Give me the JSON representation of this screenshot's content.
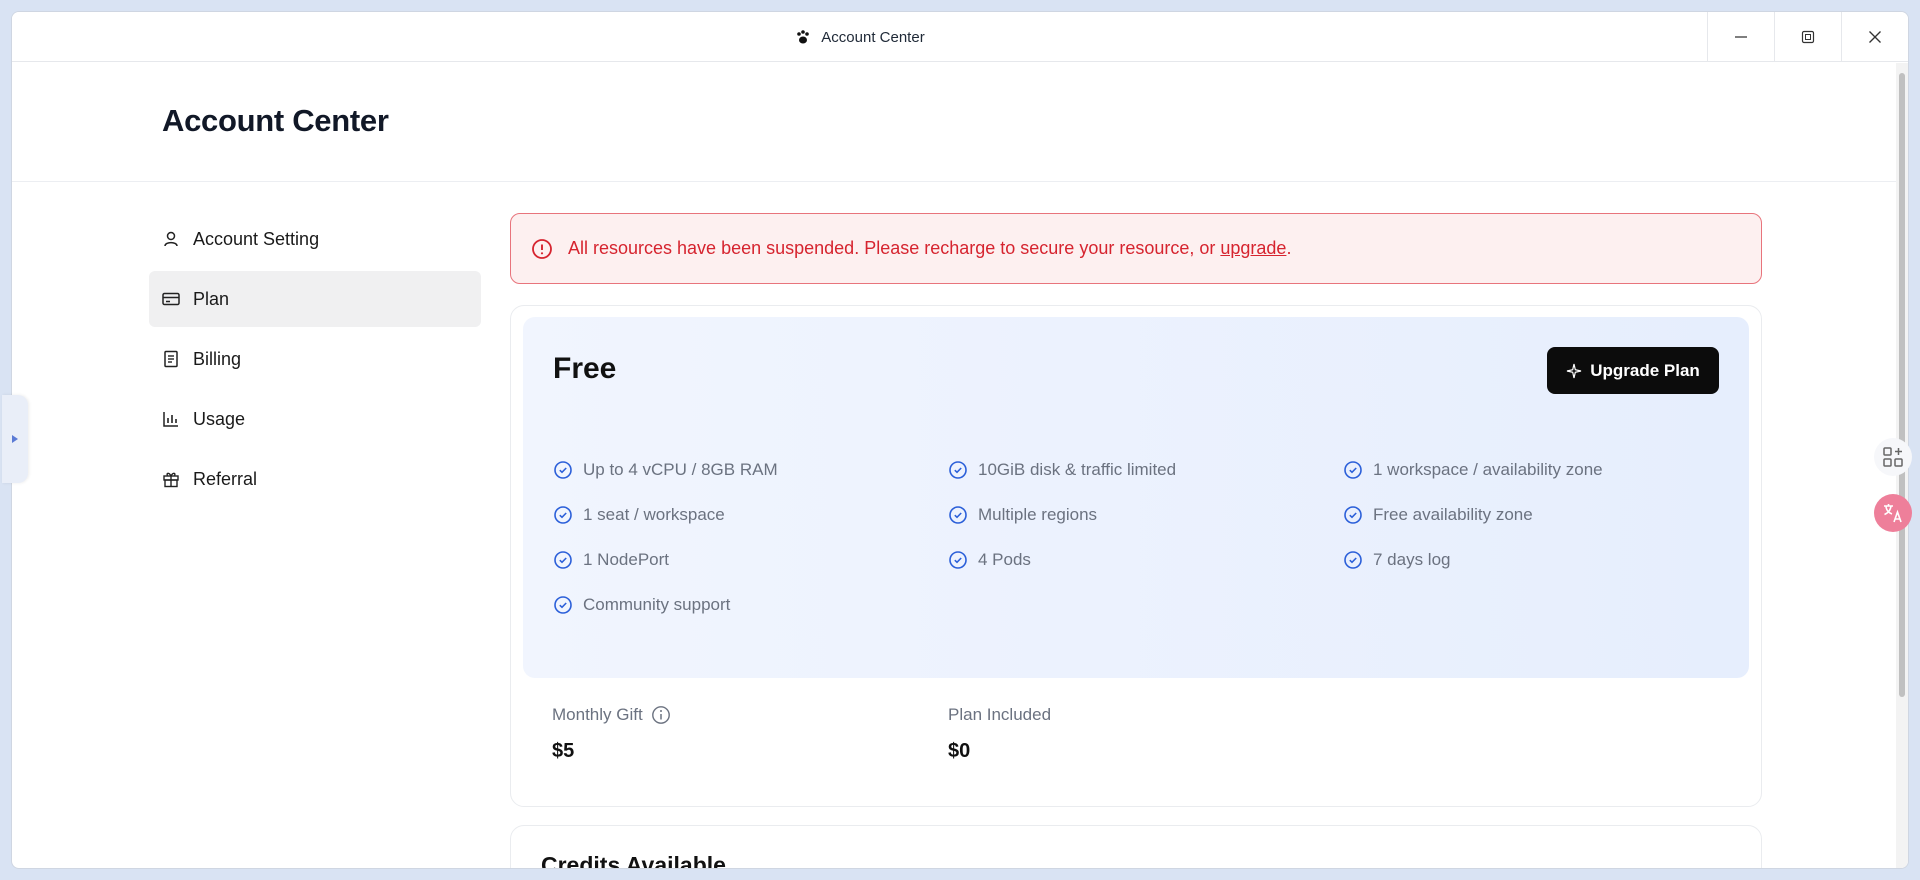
{
  "window": {
    "title": "Account Center"
  },
  "page": {
    "title": "Account Center"
  },
  "sidebar": {
    "items": [
      {
        "label": "Account Setting",
        "icon": "user-icon",
        "active": false
      },
      {
        "label": "Plan",
        "icon": "credit-card-icon",
        "active": true
      },
      {
        "label": "Billing",
        "icon": "receipt-icon",
        "active": false
      },
      {
        "label": "Usage",
        "icon": "bar-chart-icon",
        "active": false
      },
      {
        "label": "Referral",
        "icon": "gift-icon",
        "active": false
      }
    ]
  },
  "alert": {
    "message": "All resources have been suspended. Please recharge to secure your resource, or ",
    "link_text": "upgrade",
    "suffix": "."
  },
  "plan": {
    "name": "Free",
    "upgrade_label": "Upgrade Plan",
    "features": [
      "Up to 4 vCPU / 8GB RAM",
      "10GiB disk & traffic limited",
      "1 workspace / availability zone",
      "1 seat / workspace",
      "Multiple regions",
      "Free availability zone",
      "1 NodePort",
      "4 Pods",
      "7 days log",
      "Community support"
    ],
    "monthly_gift_label": "Monthly Gift",
    "monthly_gift_value": "$5",
    "plan_included_label": "Plan Included",
    "plan_included_value": "$0"
  },
  "credits": {
    "title": "Credits Available"
  },
  "colors": {
    "accent_blue": "#2b5fd9",
    "alert_red": "#d6242f",
    "button_dark": "#0c0c0c"
  }
}
